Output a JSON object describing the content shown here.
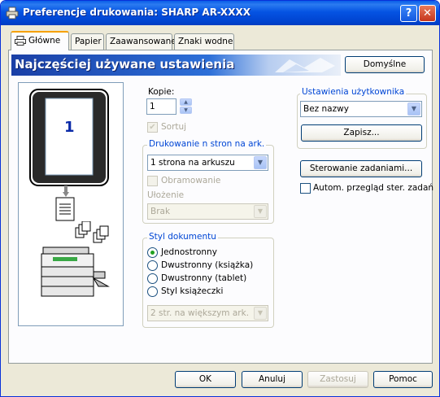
{
  "window": {
    "title": "Preferencje drukowania: SHARP AR-XXXX"
  },
  "tabs": [
    {
      "label": "Główne"
    },
    {
      "label": "Papier"
    },
    {
      "label": "Zaawansowane"
    },
    {
      "label": "Znaki wodne"
    }
  ],
  "banner": {
    "title": "Najczęściej używane ustawienia",
    "defaults_button": "Domyślne"
  },
  "preview": {
    "page_number": "1"
  },
  "copies": {
    "label": "Kopie:",
    "value": "1",
    "sort_label": "Sortuj",
    "sort_checked": true
  },
  "n_up": {
    "group_label": "Drukowanie n stron na ark.",
    "selected": "1 strona na arkuszu",
    "border_label": "Obramowanie",
    "order_label": "Ułożenie",
    "order_selected": "Brak"
  },
  "document_style": {
    "group_label": "Styl dokumentu",
    "options": [
      "Jednostronny",
      "Dwustronny (książka)",
      "Dwustronny (tablet)",
      "Styl książeczki"
    ],
    "selected_index": 0,
    "booklet_selected": "2 str. na większym ark."
  },
  "user_settings": {
    "group_label": "Ustawienia użytkownika",
    "selected": "Bez nazwy",
    "save_button": "Zapisz..."
  },
  "job_control": {
    "button": "Sterowanie zadaniami...",
    "auto_label": "Autom. przegląd ster. zadań"
  },
  "footer": {
    "ok": "OK",
    "cancel": "Anuluj",
    "apply": "Zastosuj",
    "help": "Pomoc"
  },
  "colors": {
    "title_bar": "#0554e3",
    "group_label": "#0046d5",
    "banner": "#1a3fa6"
  }
}
